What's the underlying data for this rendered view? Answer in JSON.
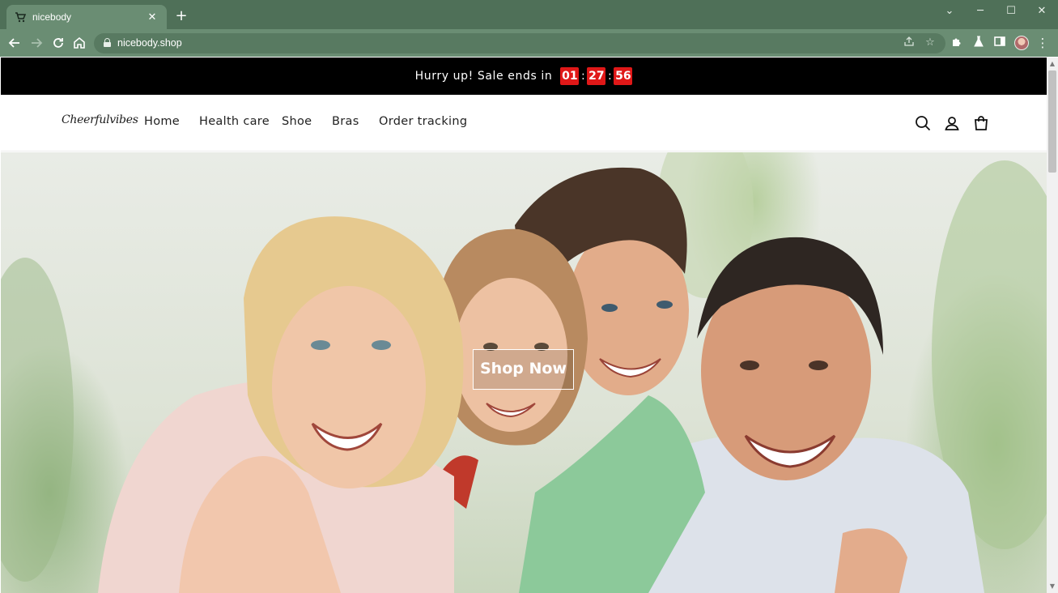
{
  "browser": {
    "tab": {
      "title": "nicebody",
      "favicon": "cart-icon"
    },
    "address_bar": {
      "url": "nicebody.shop"
    },
    "window_controls": [
      "minimize",
      "maximize",
      "close"
    ]
  },
  "announcement": {
    "text": "Hurry up! Sale ends in",
    "countdown": {
      "hours": "01",
      "minutes": "27",
      "seconds": "56",
      "separator": ":"
    },
    "background": "#000000",
    "countdown_color": "#e01818"
  },
  "header": {
    "logo": "Cheerfulvibes",
    "nav": [
      {
        "label": "Home"
      },
      {
        "label": "Health care"
      },
      {
        "label": "Shoe"
      },
      {
        "label": "Bras"
      },
      {
        "label": "Order tracking"
      }
    ],
    "icons": [
      "search-icon",
      "account-icon",
      "cart-icon"
    ]
  },
  "hero": {
    "button_label": "Shop Now",
    "image": "family-piggyback-photo"
  },
  "colors": {
    "chrome_frame": "#4f7058",
    "chrome_toolbar": "#6a8d73"
  }
}
